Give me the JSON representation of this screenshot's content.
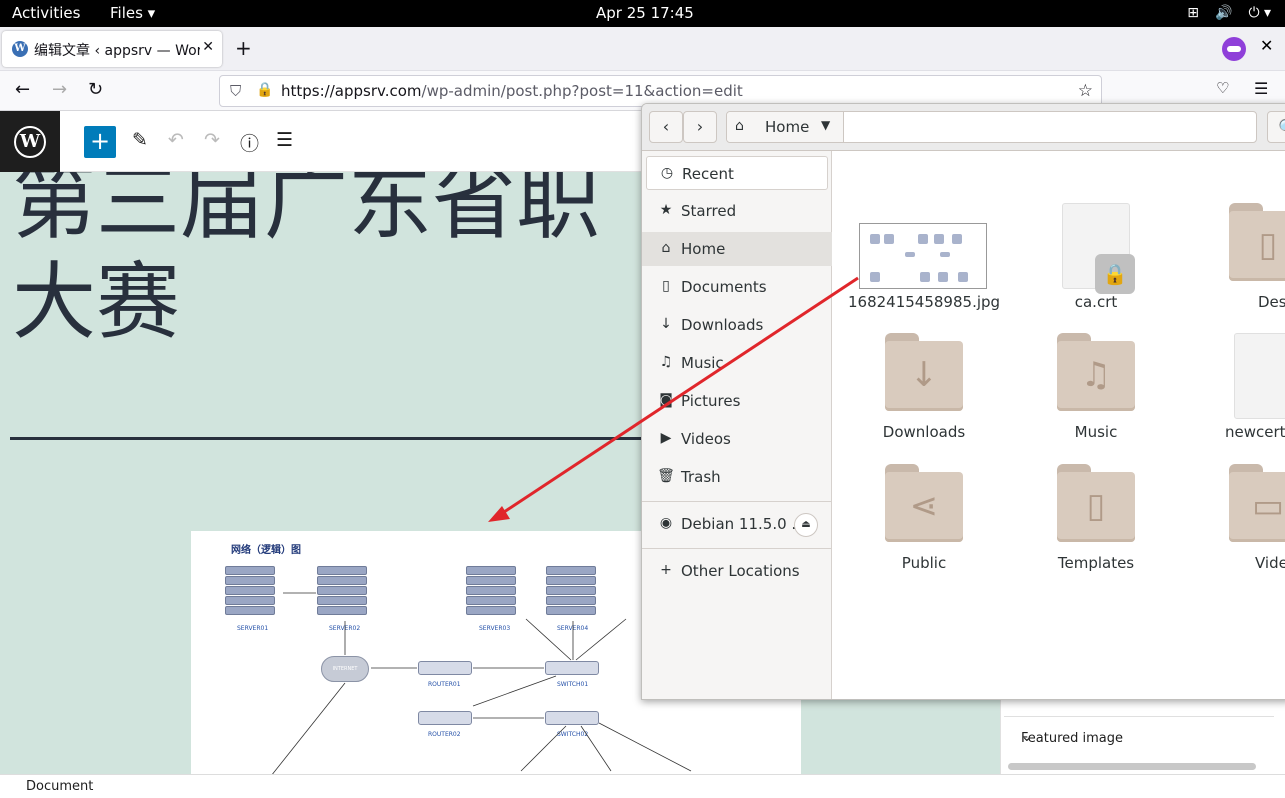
{
  "topbar": {
    "activities": "Activities",
    "files_menu": "Files ▾",
    "clock": "Apr 25  17:45",
    "network_icon": "⊞",
    "volume_icon": "🔊",
    "power_icon": "⏻ ▾"
  },
  "browser": {
    "tab_title": "编辑文章 ‹ appsrv — Wor",
    "tab_close": "✕",
    "new_tab": "+",
    "win_close": "✕",
    "back": "←",
    "forward": "→",
    "reload": "↻",
    "url_host": "https://appsrv.com",
    "url_path": "/wp-admin/post.php?post=11&action=edit",
    "pocket": "♡",
    "menu": "☰"
  },
  "wp": {
    "logo": "W",
    "add_block": "+",
    "heading_line1": "第三届广东省职",
    "heading_line2": "大赛",
    "diagram_title": "网络（逻辑）图",
    "diagram_labels": {
      "server01": "SERVER01",
      "server02": "SERVER02",
      "server03": "SERVER03",
      "server04": "SERVER04",
      "internet": "INTERNET",
      "router01": "ROUTER01",
      "router02": "ROUTER02",
      "switch01": "SWITCH01",
      "switch02": "SWITCH02"
    },
    "featured_image": "Featured image",
    "status": "Document"
  },
  "nautilus": {
    "path_label": "Home",
    "sidebar": [
      {
        "label": "Recent",
        "icon": "◷"
      },
      {
        "label": "Starred",
        "icon": "★"
      },
      {
        "label": "Home",
        "icon": "⌂"
      },
      {
        "label": "Documents",
        "icon": "▯"
      },
      {
        "label": "Downloads",
        "icon": "↓"
      },
      {
        "label": "Music",
        "icon": "♫"
      },
      {
        "label": "Pictures",
        "icon": "◙"
      },
      {
        "label": "Videos",
        "icon": "▶"
      },
      {
        "label": "Trash",
        "icon": "🗑"
      }
    ],
    "device": {
      "label": "Debian 11.5.0 ...",
      "icon": "◉",
      "eject": "⏏"
    },
    "other_locations": {
      "label": "Other Locations",
      "icon": "+"
    },
    "files": [
      {
        "name": "1682415458985.jpg",
        "kind": "image"
      },
      {
        "name": "ca.crt",
        "kind": "locked-doc"
      },
      {
        "name": "Deskto",
        "kind": "folder",
        "glyph": "▯"
      },
      {
        "name": "Downloads",
        "kind": "folder",
        "glyph": "↓"
      },
      {
        "name": "Music",
        "kind": "folder",
        "glyph": "♫"
      },
      {
        "name": "newcert.p",
        "kind": "doc"
      },
      {
        "name": "Public",
        "kind": "folder",
        "glyph": "⋖"
      },
      {
        "name": "Templates",
        "kind": "folder",
        "glyph": "▯"
      },
      {
        "name": "Videos",
        "kind": "folder",
        "glyph": "▭"
      }
    ]
  }
}
